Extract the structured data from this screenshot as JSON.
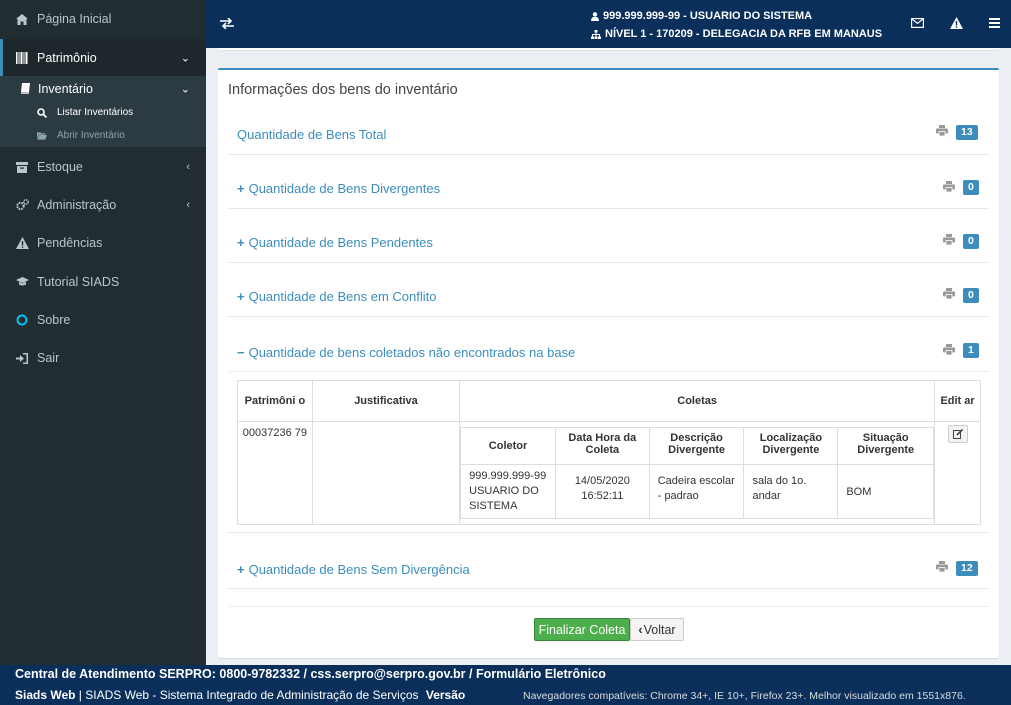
{
  "sidebar": {
    "home": "Página Inicial",
    "patrimonio": "Patrimônio",
    "inventario": "Inventário",
    "listar": "Listar Inventários",
    "abrir": "Abrir Inventário",
    "estoque": "Estoque",
    "administracao": "Administração",
    "pendencias": "Pendências",
    "tutorial": "Tutorial SIADS",
    "sobre": "Sobre",
    "sair": "Sair"
  },
  "header": {
    "user": "999.999.999-99 - USUARIO DO SISTEMA",
    "unit": "NÍVEL 1 - 170209 - DELEGACIA DA RFB EM MANAUS"
  },
  "box": {
    "title": "Informações dos bens do inventário"
  },
  "sections": [
    {
      "label": "Quantidade de Bens Total",
      "count": "13",
      "prefix": ""
    },
    {
      "label": "Quantidade de Bens Divergentes",
      "count": "0",
      "prefix": "+"
    },
    {
      "label": "Quantidade de Bens Pendentes",
      "count": "0",
      "prefix": "+"
    },
    {
      "label": "Quantidade de Bens em Conflito",
      "count": "0",
      "prefix": "+"
    },
    {
      "label": "Quantidade de bens coletados não encontrados na base",
      "count": "1",
      "prefix": "−"
    },
    {
      "label": "Quantidade de Bens Sem Divergência",
      "count": "12",
      "prefix": "+"
    }
  ],
  "table": {
    "headers": [
      "Patrimôni o",
      "Justificativa",
      "Coletas",
      "Edit ar"
    ],
    "inner_headers": [
      "Coletor",
      "Data Hora da Coleta",
      "Descrição Divergente",
      "Localização Divergente",
      "Situação Divergente"
    ],
    "row": {
      "patrimonio": "00037236 79",
      "justificativa": "",
      "coletor": "999.999.999-99 USUARIO DO SISTEMA",
      "data": "14/05/2020 16:52:11",
      "descricao": "Cadeira escolar - padrao",
      "localizacao": "sala do 1o. andar",
      "situacao": "BOM"
    }
  },
  "buttons": {
    "finalizar": "Finalizar Coleta",
    "voltar": "Voltar"
  },
  "footer": {
    "line1": "Central de Atendimento SERPRO: 0800-9782332 / css.serpro@serpro.gov.br / Formulário Eletrônico",
    "brand": "Siads Web",
    "desc": " | SIADS Web - Sistema Integrado de Administração de Serviços ",
    "versao": "Versão",
    "compat": "Navegadores compatíveis: Chrome 34+, IE 10+, Firefox 23+. Melhor visualizado em 1551x876."
  }
}
